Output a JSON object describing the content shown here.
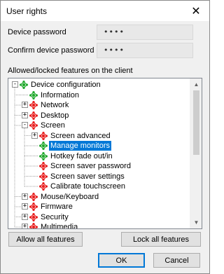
{
  "window": {
    "title": "User rights",
    "close_glyph": "✕"
  },
  "fields": {
    "device_password_label": "Device password",
    "device_password_value": "••••",
    "confirm_password_label": "Confirm device password",
    "confirm_password_value": "••••"
  },
  "section_label": "Allowed/locked features on the client",
  "colors": {
    "allowed": "#1fa82b",
    "locked": "#e81d1d",
    "selection": "#0078d7"
  },
  "tree": {
    "items": [
      {
        "label": "Device configuration",
        "status": "allowed",
        "expander": "minus"
      },
      {
        "label": "Information",
        "status": "allowed"
      },
      {
        "label": "Network",
        "status": "locked",
        "expander": "plus"
      },
      {
        "label": "Desktop",
        "status": "locked",
        "expander": "plus"
      },
      {
        "label": "Screen",
        "status": "locked",
        "expander": "minus"
      },
      {
        "label": "Screen advanced",
        "status": "locked",
        "expander": "plus"
      },
      {
        "label": "Manage monitors",
        "status": "allowed",
        "selected": true
      },
      {
        "label": "Hotkey fade out/in",
        "status": "allowed"
      },
      {
        "label": "Screen saver password",
        "status": "locked"
      },
      {
        "label": "Screen saver settings",
        "status": "locked"
      },
      {
        "label": "Calibrate touchscreen",
        "status": "locked"
      },
      {
        "label": "Mouse/Keyboard",
        "status": "locked",
        "expander": "plus"
      },
      {
        "label": "Firmware",
        "status": "locked",
        "expander": "plus"
      },
      {
        "label": "Security",
        "status": "locked",
        "expander": "plus"
      },
      {
        "label": "Multimedia",
        "status": "locked",
        "expander": "plus"
      }
    ]
  },
  "buttons": {
    "allow_all": "Allow all features",
    "lock_all": "Lock all features",
    "ok": "OK",
    "cancel": "Cancel"
  }
}
